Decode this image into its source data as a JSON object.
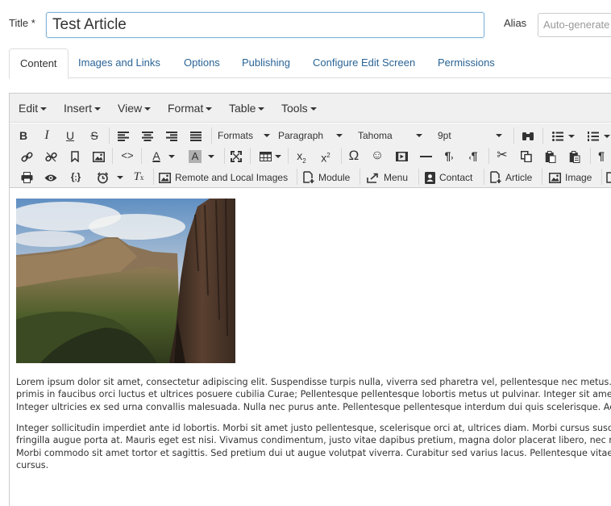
{
  "form": {
    "title_label": "Title *",
    "title_value": "Test Article",
    "alias_label": "Alias",
    "alias_placeholder": "Auto-generate"
  },
  "tabs": [
    {
      "label": "Content",
      "active": true
    },
    {
      "label": "Images and Links"
    },
    {
      "label": "Options"
    },
    {
      "label": "Publishing"
    },
    {
      "label": "Configure Edit Screen"
    },
    {
      "label": "Permissions"
    }
  ],
  "menubar": [
    "Edit",
    "Insert",
    "View",
    "Format",
    "Table",
    "Tools"
  ],
  "toolbar": {
    "formats": "Formats",
    "block": "Paragraph",
    "font_family": "Tahoma",
    "font_size": "9pt",
    "remote_images": "Remote and Local Images",
    "module": "Module",
    "menu": "Menu",
    "contact": "Contact",
    "article": "Article",
    "image": "Image"
  },
  "content": {
    "image_description": "mountain landscape photo",
    "paragraph1": [
      "Lorem ipsum dolor sit amet, consectetur adipiscing elit. Suspendisse turpis nulla, viverra sed pharetra vel, pellentesque nec metus. Nunc v",
      "primis in faucibus orci luctus et ultrices posuere cubilia Curae; Pellentesque pellentesque lobortis metus ut pulvinar. Integer sit amet turpi",
      "Integer ultricies ex sed urna convallis malesuada. Nulla nec purus ante. Pellentesque pellentesque interdum dui quis scelerisque. Aenean"
    ],
    "paragraph2": [
      "Integer sollicitudin imperdiet ante id lobortis. Morbi sit amet justo pellentesque, scelerisque orci at, ultrices diam. Morbi cursus suscipit co",
      "fringilla augue porta at. Mauris eget est nisi. Vivamus condimentum, justo vitae dapibus pretium, magna dolor placerat libero, nec rutrum",
      "Morbi commodo sit amet tortor et sagittis. Sed pretium dui ut augue volutpat viverra. Curabitur sed varius lacus. Pellentesque vitae volutp",
      "cursus."
    ]
  },
  "colors": {
    "link": "#2a6496",
    "input_focus_border": "#7fb1d6",
    "toolbar_bg": "#f0f0f0"
  }
}
